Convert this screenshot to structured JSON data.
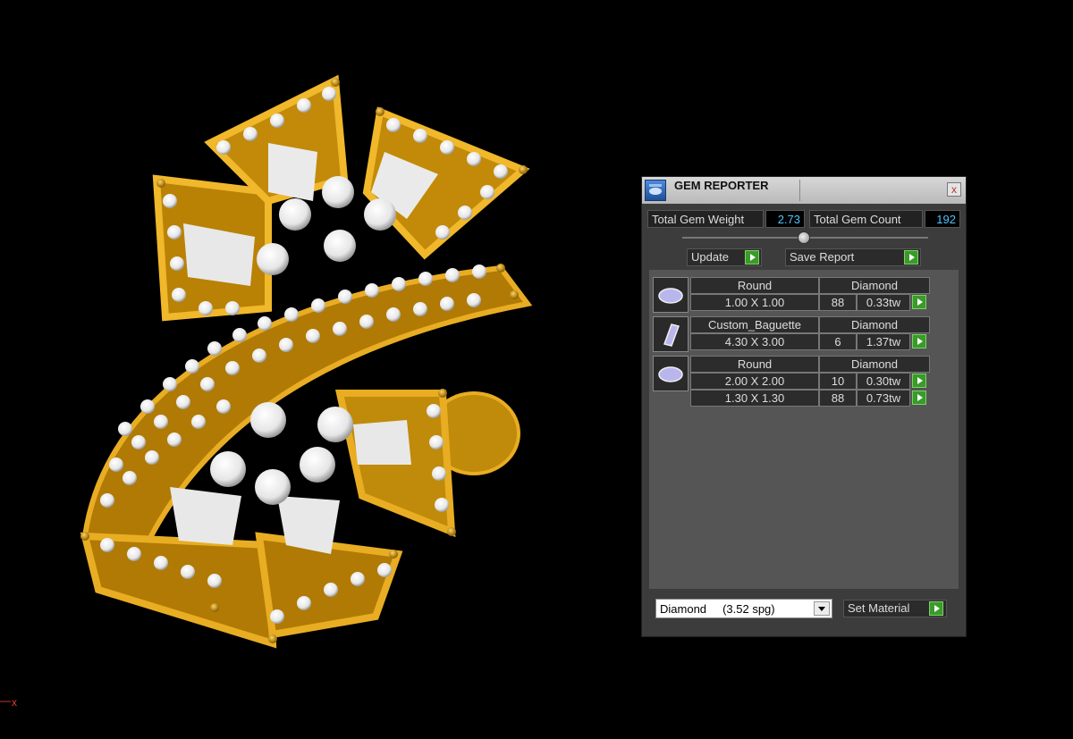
{
  "window": {
    "title": "GEM REPORTER",
    "close_label": "x"
  },
  "stats": {
    "weight_label": "Total Gem Weight",
    "weight_value": "2.73",
    "count_label": "Total Gem Count",
    "count_value": "192"
  },
  "buttons": {
    "update": "Update",
    "save_report": "Save Report",
    "set_material": "Set Material"
  },
  "gems": [
    {
      "shape": "Round",
      "material": "Diamond",
      "icon": "round-gem-icon",
      "sizes": [
        {
          "size": "1.00 X 1.00",
          "count": "88",
          "weight": "0.33tw"
        }
      ]
    },
    {
      "shape": "Custom_Baguette",
      "material": "Diamond",
      "icon": "baguette-gem-icon",
      "sizes": [
        {
          "size": "4.30 X 3.00",
          "count": "6",
          "weight": "1.37tw"
        }
      ]
    },
    {
      "shape": "Round",
      "material": "Diamond",
      "icon": "round-gem-icon",
      "sizes": [
        {
          "size": "2.00 X 2.00",
          "count": "10",
          "weight": "0.30tw"
        },
        {
          "size": "1.30 X 1.30",
          "count": "88",
          "weight": "0.73tw"
        }
      ]
    }
  ],
  "material_select": {
    "value": "Diamond     (3.52 spg)"
  },
  "axis": {
    "x_label": "x"
  },
  "colors": {
    "gold": "#d39a10",
    "panel": "#3c3c3c",
    "value_text": "#4fc3ff",
    "go_green": "#3a9a2a"
  }
}
